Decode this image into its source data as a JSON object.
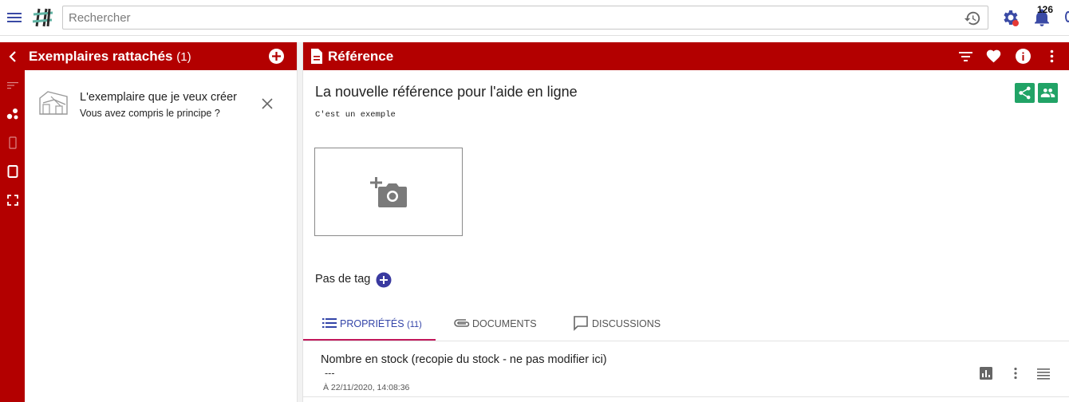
{
  "topbar": {
    "search_placeholder": "Rechercher",
    "notification_count": "126"
  },
  "left_panel": {
    "title": "Exemplaires rattachés",
    "count": "(1)",
    "items": [
      {
        "title": "L'exemplaire que je veux créer",
        "subtitle": "Vous avez compris le principe ?"
      }
    ]
  },
  "right_panel": {
    "header_title": "Référence",
    "reference_title": "La nouvelle référence pour l'aide en ligne",
    "reference_subtitle": "C'est un exemple",
    "tags_label": "Pas de tag",
    "tabs": [
      {
        "label": "PROPRIÉTÉS",
        "count": "(11)",
        "active": true
      },
      {
        "label": "DOCUMENTS"
      },
      {
        "label": "DISCUSSIONS"
      }
    ],
    "properties": [
      {
        "name": "Nombre en stock (recopie du stock - ne pas modifier ici)",
        "value": "---",
        "date": "À 22/11/2020, 14:08:36"
      }
    ]
  },
  "colors": {
    "brand_red": "#b30000",
    "accent_green": "#21a366",
    "active_tab": "#3344a8",
    "tab_underline": "#c2185b"
  },
  "icons": [
    "menu-icon",
    "app-logo",
    "history-icon",
    "gear-icon",
    "bell-icon",
    "chevron-left-icon",
    "add-circle-icon",
    "document-icon",
    "filter-icon",
    "heart-icon",
    "info-icon",
    "more-vert-icon",
    "share-icon",
    "group-icon",
    "add-photo-icon",
    "list-icon",
    "attachment-icon",
    "chat-icon",
    "bar-chart-icon",
    "menu-lines-icon",
    "close-icon"
  ]
}
